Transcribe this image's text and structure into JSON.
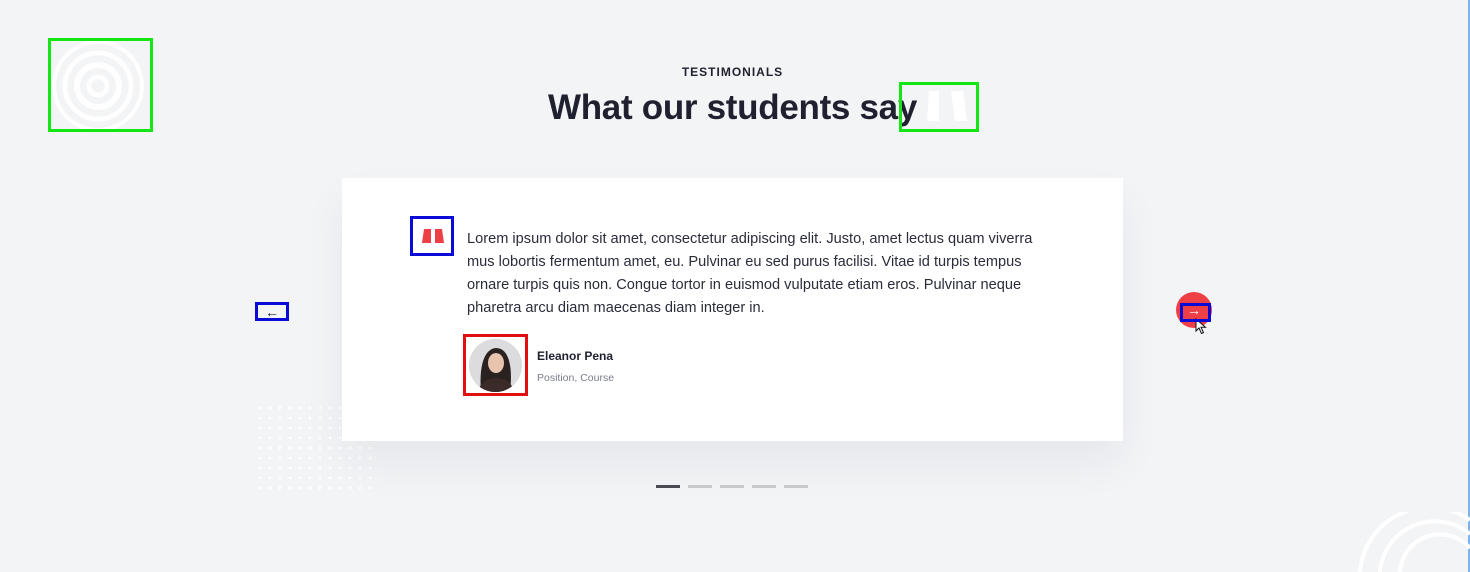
{
  "section": {
    "eyebrow": "TESTIMONIALS",
    "title": "What our students say"
  },
  "testimonial": {
    "quote": "Lorem ipsum dolor sit amet, consectetur adipiscing elit. Justo, amet lectus quam viverra mus lobortis fermentum amet, eu. Pulvinar eu sed purus facilisi. Vitae id turpis tempus ornare turpis quis non. Congue tortor in euismod vulputate etiam eros. Pulvinar neque pharetra arcu diam maecenas diam integer in.",
    "author_name": "Eleanor Pena",
    "author_role": "Position, Course"
  },
  "navigation": {
    "prev_glyph": "←",
    "next_glyph": "→",
    "slide_count": 5,
    "active_slide": 1
  },
  "colors": {
    "accent": "#ee3e46",
    "background": "#f3f4f6",
    "heading": "#1f2130"
  },
  "icons": [
    "concentric-rings-icon",
    "quote-mark-icon",
    "arrow-left-icon",
    "arrow-right-icon",
    "mouse-cursor-icon"
  ]
}
